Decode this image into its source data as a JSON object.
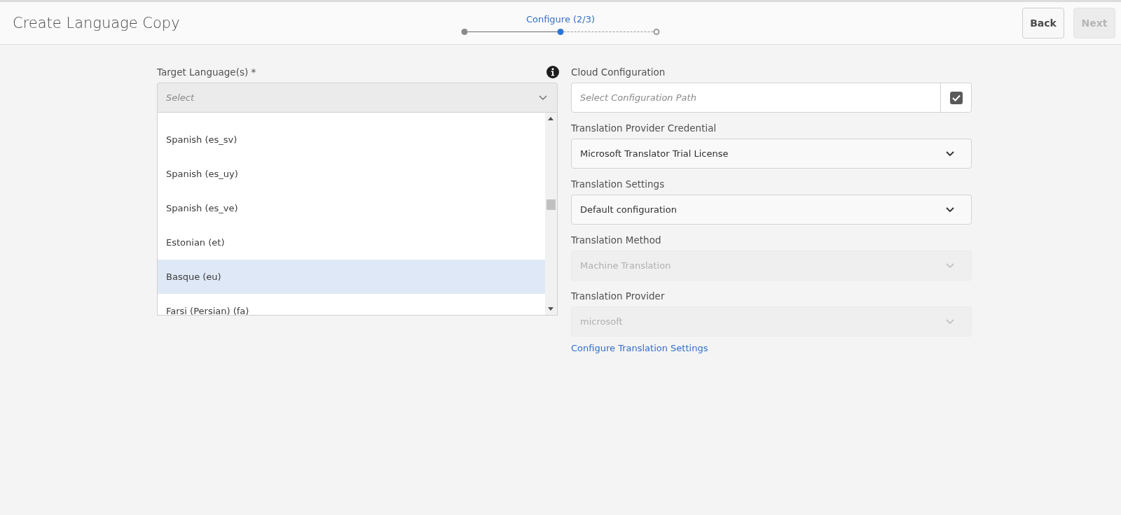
{
  "header": {
    "title": "Create Language Copy",
    "stepper": {
      "label": "Configure (2/3)",
      "steps": [
        {
          "done": true,
          "selected": false
        },
        {
          "done": false,
          "selected": true
        },
        {
          "done": false,
          "selected": false
        }
      ]
    },
    "buttons": [
      {
        "label": "Back",
        "disabled": false
      },
      {
        "label": "Next",
        "disabled": true
      }
    ]
  },
  "target_languages": {
    "label": "Target Language(s) *",
    "placeholder": "Select",
    "expanded": true,
    "options": [
      {
        "label": "Spanish (es_sv)",
        "selected": false
      },
      {
        "label": "Spanish (es_uy)",
        "selected": false
      },
      {
        "label": "Spanish (es_ve)",
        "selected": false
      },
      {
        "label": "Estonian (et)",
        "selected": false
      },
      {
        "label": "Basque (eu)",
        "selected": true
      },
      {
        "label": "Farsi (Persian) (fa)",
        "selected": false
      }
    ]
  },
  "fields": [
    {
      "kind": "path",
      "label": "Cloud Configuration",
      "placeholder": "Select Configuration Path",
      "checked": true,
      "disabled": false
    },
    {
      "kind": "select",
      "label": "Translation Provider Credential",
      "value": "Microsoft Translator Trial License",
      "disabled": false
    },
    {
      "kind": "select",
      "label": "Translation Settings",
      "value": "Default configuration",
      "disabled": false
    },
    {
      "kind": "select",
      "label": "Translation Method",
      "value": "Machine Translation",
      "disabled": true
    },
    {
      "kind": "select",
      "label": "Translation Provider",
      "value": "microsoft",
      "disabled": true
    }
  ],
  "link": "Configure Translation Settings"
}
